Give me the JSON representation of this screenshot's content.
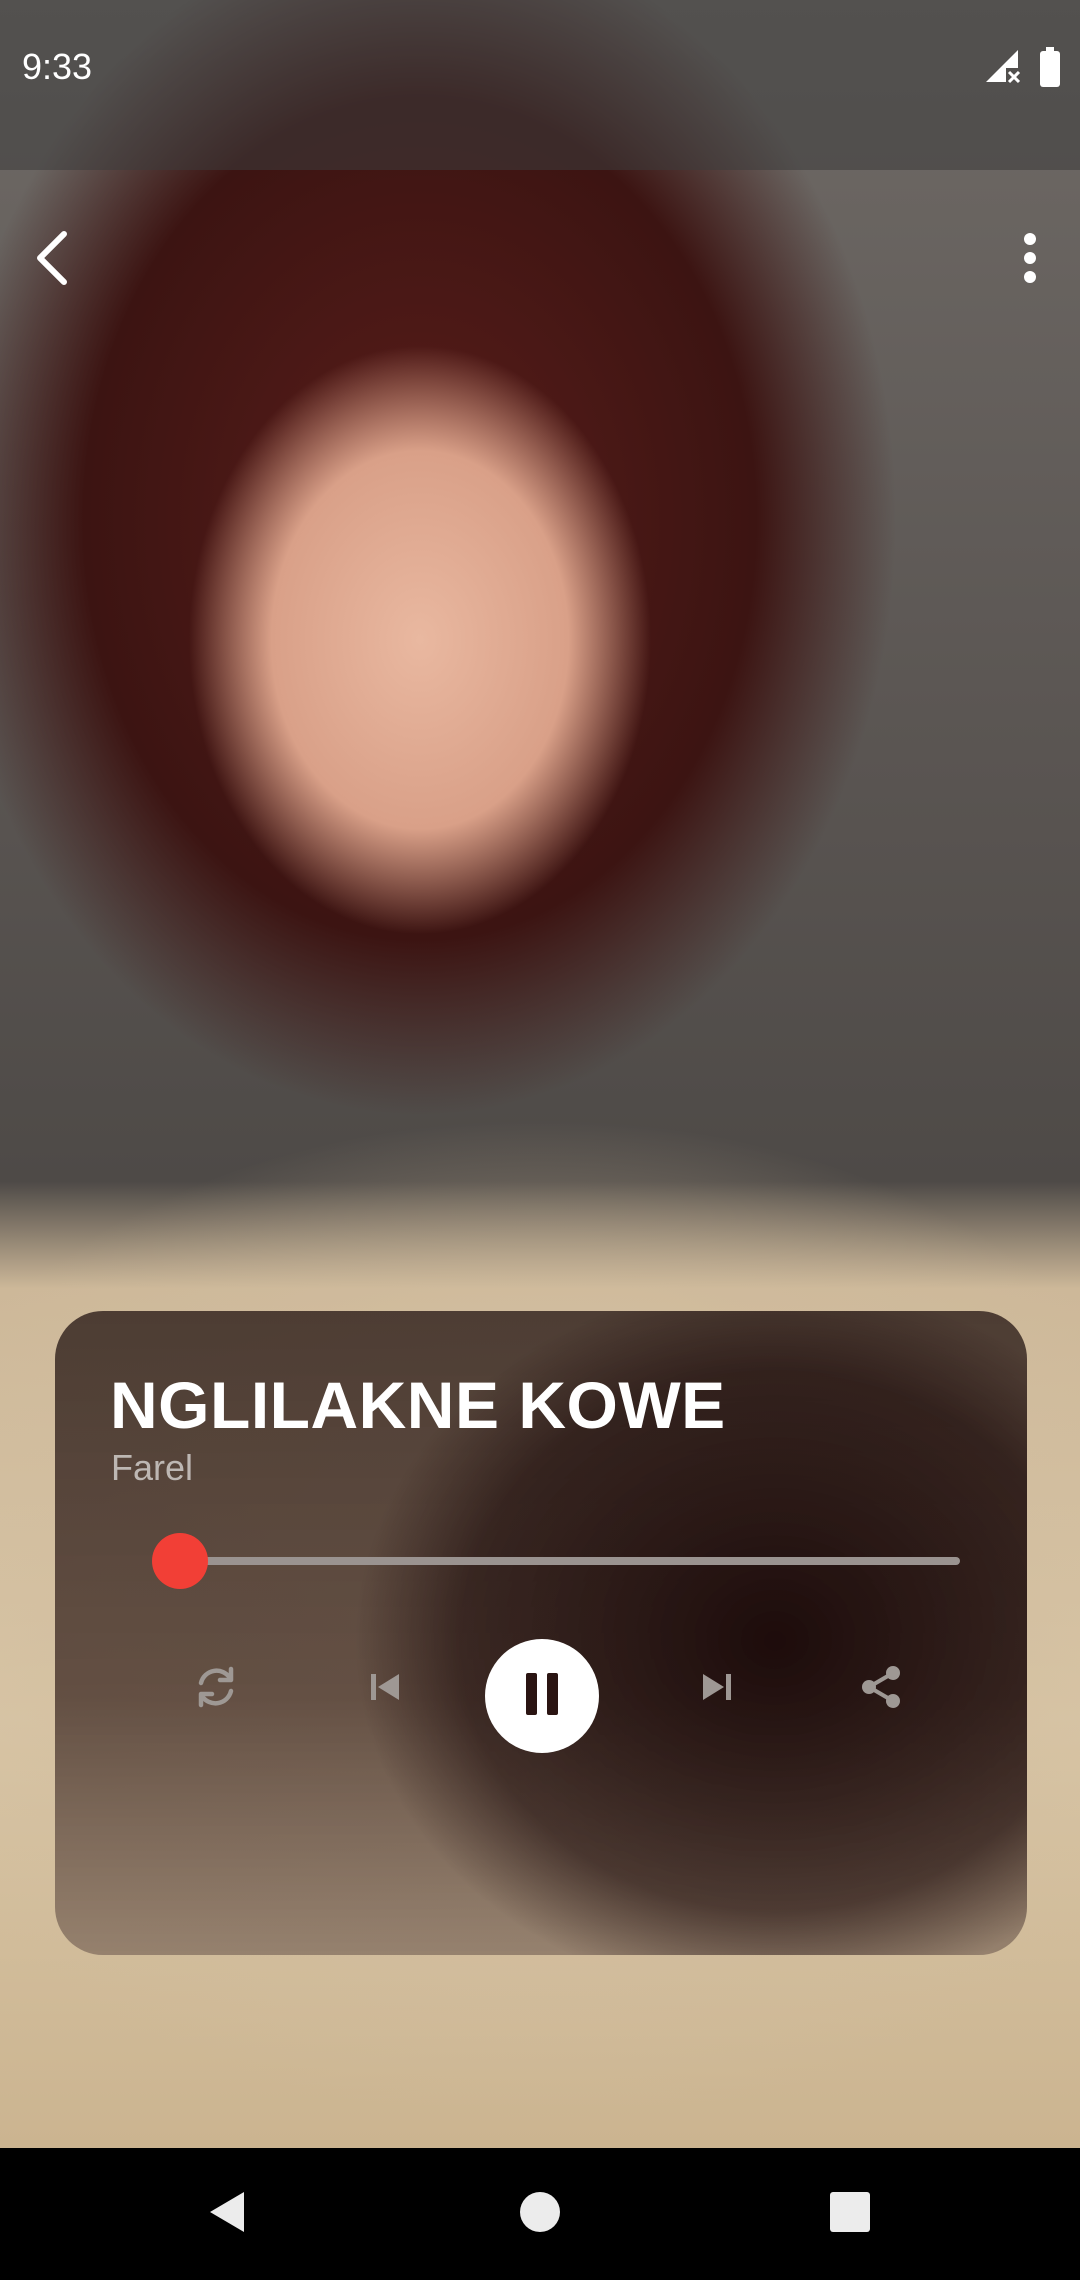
{
  "status_bar": {
    "time": "9:33",
    "icons": [
      "no-signal-icon",
      "battery-icon"
    ]
  },
  "top_bar": {
    "back_icon": "chevron-left-icon",
    "menu_icon": "more-vertical-icon"
  },
  "player": {
    "title": "NGLILAKNE KOWE",
    "artist": "Farel",
    "progress_fraction": 0.0,
    "accent_color": "#f23f36",
    "controls": [
      "repeat-icon",
      "skip-previous-icon",
      "pause-icon",
      "skip-next-icon",
      "share-icon"
    ],
    "state": "playing"
  },
  "nav_bar": {
    "icons": [
      "nav-back-icon",
      "nav-home-icon",
      "nav-recents-icon"
    ]
  }
}
